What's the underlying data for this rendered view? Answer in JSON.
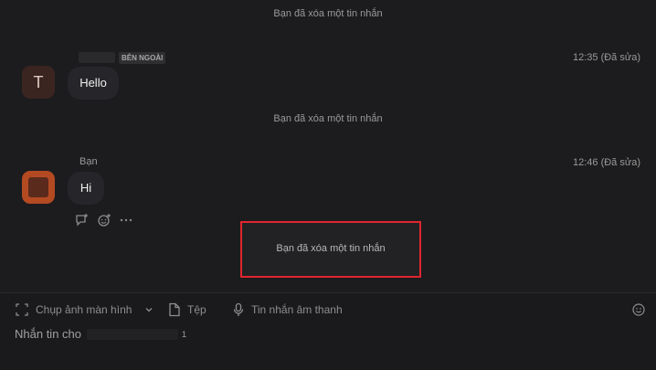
{
  "chat": {
    "system_deleted_1": "Bạn đã xóa một tin nhắn",
    "message1": {
      "avatar_letter": "T",
      "badge": "BÊN NGOÀI",
      "time": "12:35 (Đã sửa)",
      "text": "Hello"
    },
    "system_deleted_2": "Bạn đã xóa một tin nhắn",
    "message2": {
      "sender": "Bạn",
      "time": "12:46 (Đã sửa)",
      "text": "Hi"
    },
    "highlighted_deleted": "Bạn đã xóa một tin nhắn"
  },
  "composer": {
    "screenshot_label": "Chụp ảnh màn hình",
    "file_label": "Tệp",
    "voice_label": "Tin nhắn âm thanh",
    "placeholder": "Nhắn tin cho",
    "placeholder_suffix": "1"
  },
  "colors": {
    "background": "#1c1c1e",
    "bubble": "#26262a",
    "highlight_border": "#e0262e",
    "avatar_me": "#b34a22"
  }
}
